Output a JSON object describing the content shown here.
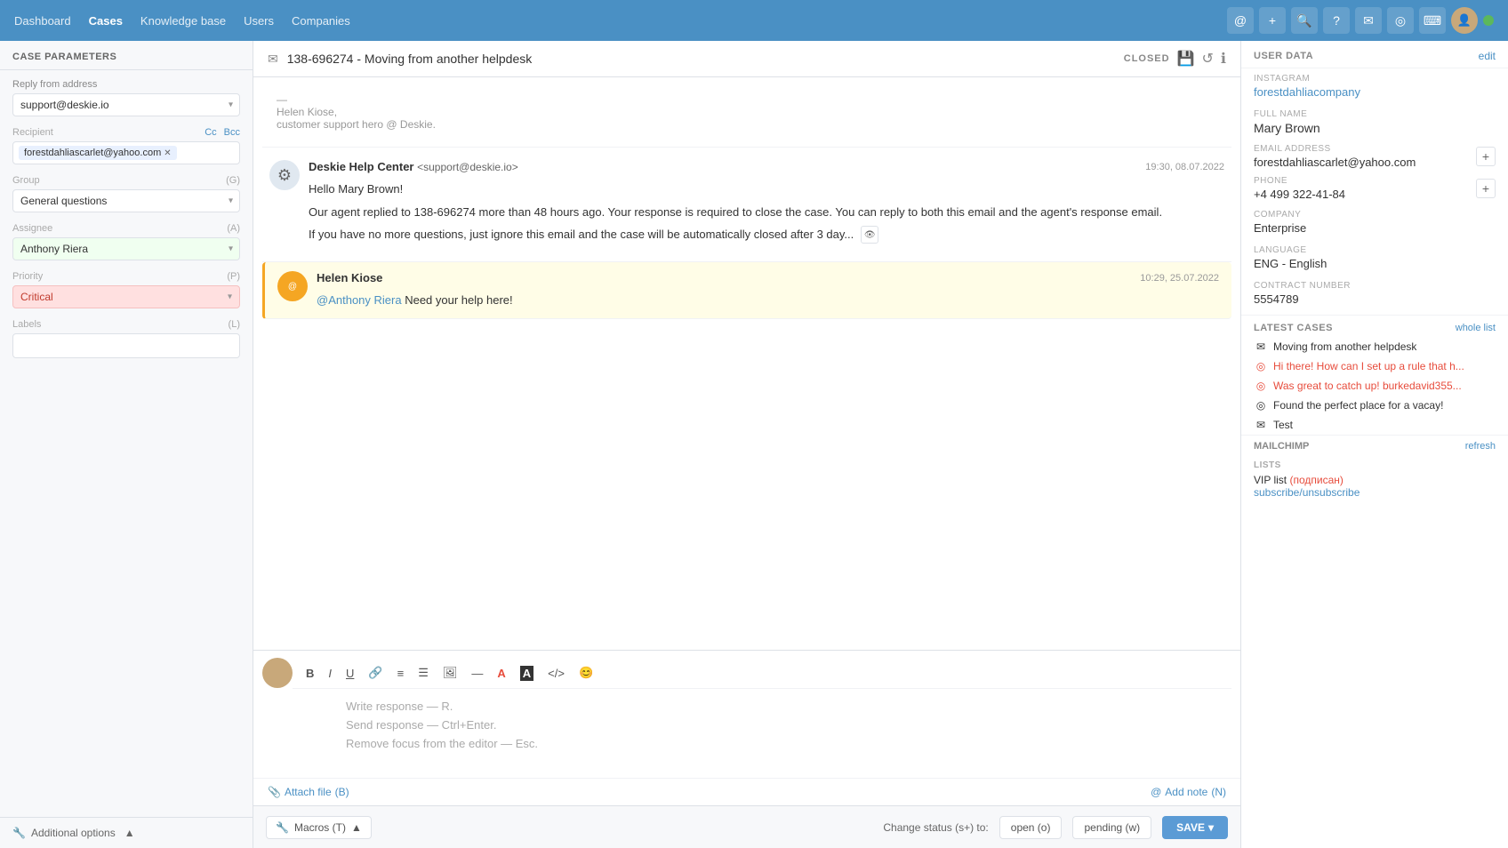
{
  "nav": {
    "items": [
      {
        "label": "Dashboard",
        "active": false
      },
      {
        "label": "Cases",
        "active": true
      },
      {
        "label": "Knowledge base",
        "active": false
      },
      {
        "label": "Users",
        "active": false
      },
      {
        "label": "Companies",
        "active": false
      }
    ],
    "icons": [
      "@",
      "+",
      "🔍",
      "?",
      "✉",
      "◎",
      "⌨"
    ]
  },
  "left_panel": {
    "title": "CASE PARAMETERS",
    "reply_from_label": "Reply from address",
    "reply_from_value": "support@deskie.io",
    "recipient_label": "Recipient",
    "recipient_email": "forestdahliascarlet@yahoo.com",
    "cc_label": "Cc",
    "bcc_label": "Bcc",
    "group_label": "Group",
    "group_shortcut": "(G)",
    "group_value": "General questions",
    "assignee_label": "Assignee",
    "assignee_shortcut": "(A)",
    "assignee_value": "Anthony Riera",
    "priority_label": "Priority",
    "priority_shortcut": "(P)",
    "priority_value": "Critical",
    "labels_label": "Labels",
    "labels_shortcut": "(L)",
    "additional_options": "Additional options"
  },
  "center": {
    "case_id": "138-696274 - Moving from another helpdesk",
    "status": "CLOSED",
    "messages": [
      {
        "id": "msg1",
        "type": "signature",
        "body": "—\nHelen Kiose,\ncustomer support hero @ Deskie."
      },
      {
        "id": "msg2",
        "type": "system",
        "sender": "Deskie Help Center",
        "sender_email": "<support@deskie.io>",
        "time": "19:30, 08.07.2022",
        "body": "Hello Mary Brown!\n\nOur agent replied to 138-696274 more than 48 hours ago. Your response is required to close the case. You can reply to both this email and the agent's response email.\n\nIf you have no more questions, just ignore this email and the case will be automatically closed after 3 day..."
      },
      {
        "id": "msg3",
        "type": "mention",
        "sender": "Helen Kiose",
        "time": "10:29, 25.07.2022",
        "mention": "@Anthony Riera",
        "body": "Need your help here!"
      }
    ],
    "editor": {
      "placeholder_line1": "Write response — R.",
      "placeholder_line2": "Send response — Ctrl+Enter.",
      "placeholder_line3": "Remove focus from the editor — Esc."
    },
    "attach_file": "Attach file",
    "attach_shortcut": "(B)",
    "add_note": "Add note",
    "add_note_shortcut": "(N)"
  },
  "bottom_bar": {
    "macros_label": "Macros (T)",
    "change_status_label": "Change status (s+) to:",
    "open_label": "open (o)",
    "pending_label": "pending (w)",
    "save_label": "SAVE"
  },
  "right_panel": {
    "title": "USER DATA",
    "edit_label": "edit",
    "instagram_label": "INSTAGRAM",
    "instagram_value": "forestdahliacompany",
    "fullname_label": "FULL NAME",
    "fullname_value": "Mary Brown",
    "email_label": "EMAIL ADDRESS",
    "email_value": "forestdahliascarlet@yahoo.com",
    "phone_label": "PHONE",
    "phone_value": "+4 499 322-41-84",
    "company_label": "COMPANY",
    "company_value": "Enterprise",
    "language_label": "LANGUAGE",
    "language_value": "ENG - English",
    "contract_label": "CONTRACT NUMBER",
    "contract_value": "5554789",
    "latest_cases_title": "LATEST CASES",
    "whole_list_label": "whole list",
    "cases": [
      {
        "icon": "✉",
        "text": "Moving from another helpdesk",
        "color": "normal"
      },
      {
        "icon": "◎",
        "text": "Hi there! How can I set up a rule that h...",
        "color": "red"
      },
      {
        "icon": "◎",
        "text": "Was great to catch up! burkedavid355...",
        "color": "red"
      },
      {
        "icon": "◎",
        "text": "Found the perfect place for a vacay!",
        "color": "normal"
      },
      {
        "icon": "✉",
        "text": "Test",
        "color": "normal"
      }
    ],
    "mailchimp_title": "Mailchimp",
    "refresh_label": "refresh",
    "lists_title": "LISTS",
    "list_items": [
      {
        "text": "VIP list",
        "subscribed": "(подписан)",
        "sub_link": "subscribe/unsubscribe"
      }
    ]
  }
}
